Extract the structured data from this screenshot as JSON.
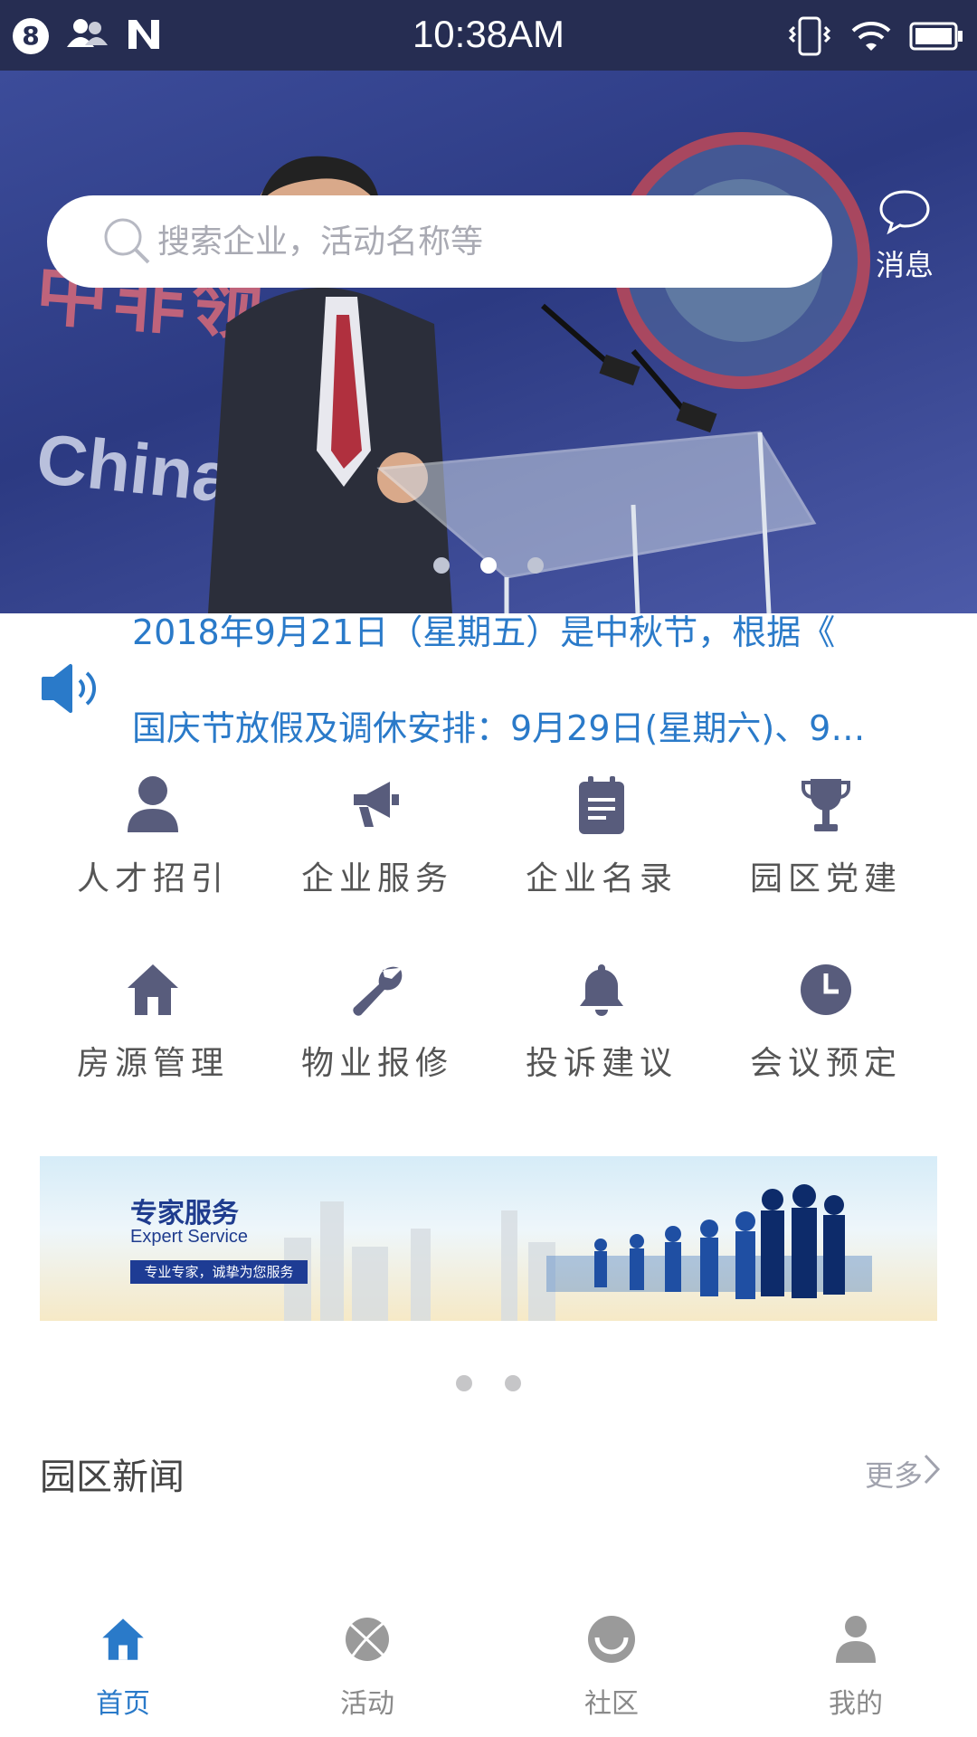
{
  "status_bar": {
    "notification_count": "8",
    "time": "10:38AM",
    "icons": [
      "contacts-icon",
      "n-logo-icon",
      "vibrate-icon",
      "wifi-icon",
      "battery-icon"
    ]
  },
  "header": {
    "search_placeholder": "搜索企业，活动名称等",
    "message_label": "消息"
  },
  "hero": {
    "banner_text_cn": "中非领",
    "banner_text_en": "China-Af",
    "carousel_page_count": 3,
    "carousel_active_index": 1
  },
  "notice": {
    "line1": "2018年9月21日（星期五）是中秋节，根据《",
    "line2": "国庆节放假及调休安排：9月29日(星期六)、9…"
  },
  "services": [
    {
      "label": "人才招引",
      "icon": "person-icon"
    },
    {
      "label": "企业服务",
      "icon": "megaphone-icon"
    },
    {
      "label": "企业名录",
      "icon": "clipboard-icon"
    },
    {
      "label": "园区党建",
      "icon": "trophy-icon"
    },
    {
      "label": "房源管理",
      "icon": "home-icon"
    },
    {
      "label": "物业报修",
      "icon": "wrench-icon"
    },
    {
      "label": "投诉建议",
      "icon": "bell-icon"
    },
    {
      "label": "会议预定",
      "icon": "clock-icon"
    }
  ],
  "banner": {
    "title": "专家服务",
    "subtitle": "Expert Service",
    "tagline": "专业专家，诚挚为您服务",
    "page_count": 2,
    "active_index": 0
  },
  "news": {
    "section_title": "园区新闻",
    "more_label": "更多"
  },
  "tab_bar": {
    "tabs": [
      {
        "label": "首页",
        "icon": "home-icon",
        "active": true
      },
      {
        "label": "活动",
        "icon": "ball-icon",
        "active": false
      },
      {
        "label": "社区",
        "icon": "smile-icon",
        "active": false
      },
      {
        "label": "我的",
        "icon": "user-icon",
        "active": false
      }
    ]
  },
  "colors": {
    "status_bar": "#262d52",
    "accent_blue": "#2a7ac9",
    "icon_slate": "#585c7c",
    "tab_inactive": "#8a8a8a"
  }
}
